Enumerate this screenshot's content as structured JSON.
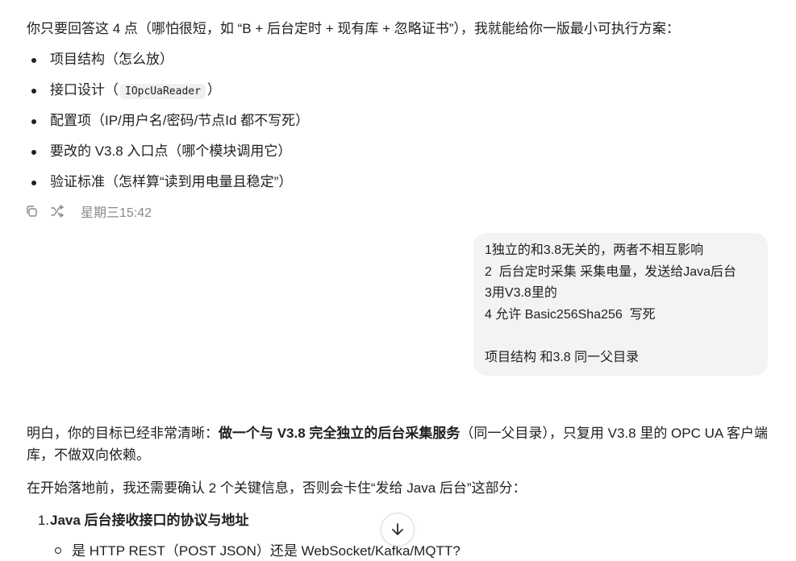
{
  "assistant_msg1": {
    "intro": "你只要回答这 4 点（哪怕很短，如 “B + 后台定时 + 现有库 + 忽略证书”），我就能给你一版最小可执行方案：",
    "bullets": [
      {
        "text": "项目结构（怎么放）"
      },
      {
        "pre": "接口设计（",
        "code": "IOpcUaReader",
        "post": "）"
      },
      {
        "text": "配置项（IP/用户名/密码/节点Id 都不写死）"
      },
      {
        "text": "要改的 V3.8 入口点（哪个模块调用它）"
      },
      {
        "text": "验证标准（怎样算“读到用电量且稳定”）"
      }
    ],
    "actions": {
      "copy_icon": "copy-icon",
      "share_icon": "branch-icon",
      "timestamp": "星期三15:42"
    }
  },
  "user_msg": {
    "lines": [
      "1独立的和3.8无关的，两者不相互影响",
      "2  后台定时采集 采集电量，发送给Java后台",
      "3用V3.8里的",
      "4 允许 Basic256Sha256  写死",
      "",
      "项目结构 和3.8 同一父目录"
    ]
  },
  "assistant_msg2": {
    "p1_pre": "明白，你的目标已经非常清晰：",
    "p1_bold": "做一个与 V3.8 完全独立的后台采集服务",
    "p1_post": "（同一父目录），只复用 V3.8 里的 OPC UA 客户端库，不做双向依赖。",
    "p2": "在开始落地前，我还需要确认 2 个关键信息，否则会卡住“发给 Java 后台”这部分：",
    "ol1_num": "1.",
    "ol1_text": "Java 后台接收接口的协议与地址",
    "sub1": "是 HTTP REST（POST JSON）还是 WebSocket/Kafka/MQTT?"
  },
  "scroll_down_icon": "arrow-down-icon"
}
